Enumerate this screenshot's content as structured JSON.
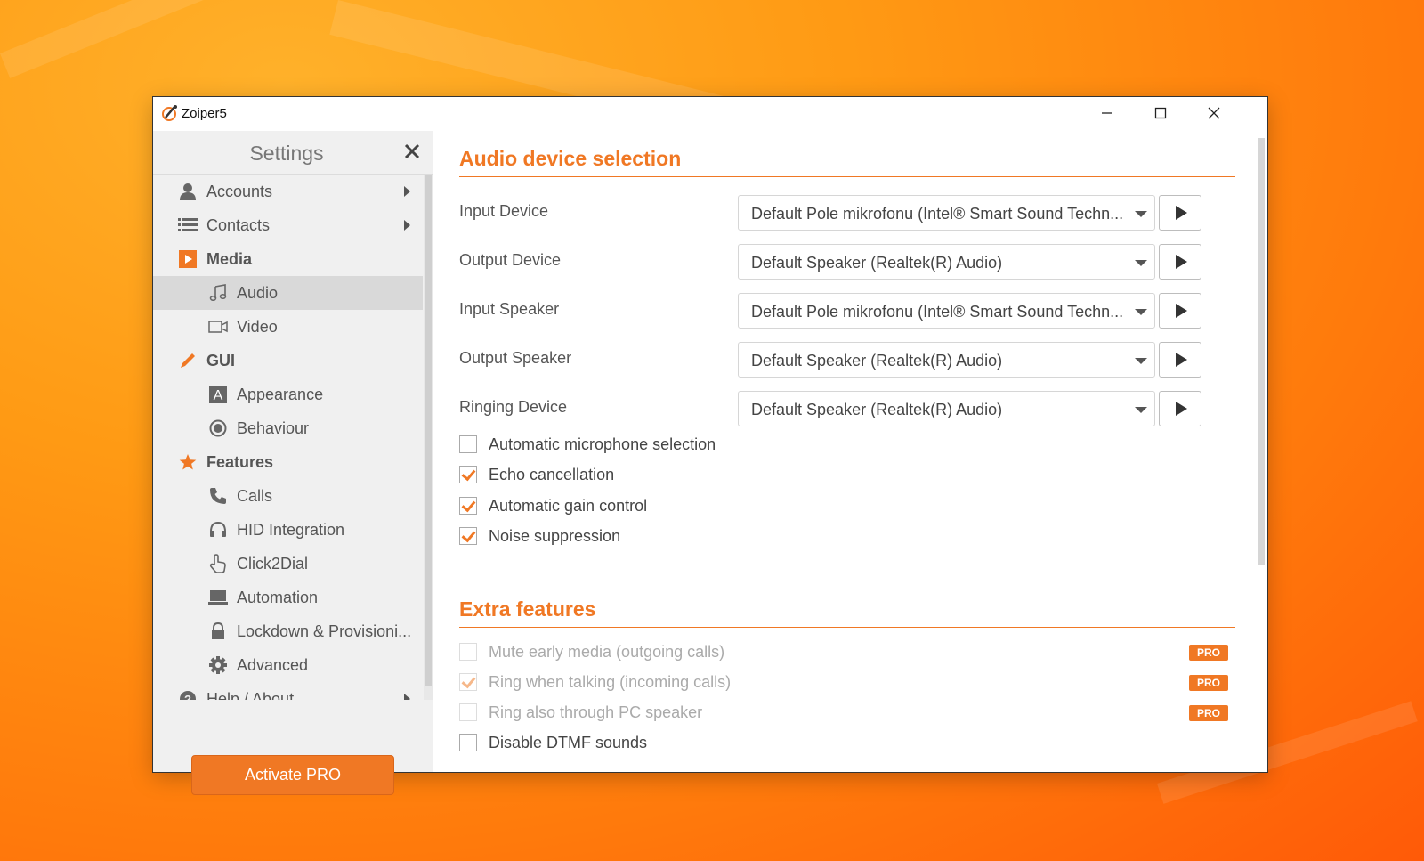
{
  "window": {
    "title": "Zoiper5"
  },
  "sidebar": {
    "title": "Settings",
    "items": [
      {
        "label": "Accounts",
        "icon": "user-icon"
      },
      {
        "label": "Contacts",
        "icon": "list-icon"
      },
      {
        "label": "Media",
        "icon": "media-play-icon"
      },
      {
        "label": "Audio",
        "icon": "music-note-icon"
      },
      {
        "label": "Video",
        "icon": "video-camera-icon"
      },
      {
        "label": "GUI",
        "icon": "pencil-icon"
      },
      {
        "label": "Appearance",
        "icon": "appearance-a-icon"
      },
      {
        "label": "Behaviour",
        "icon": "radio-circle-icon"
      },
      {
        "label": "Features",
        "icon": "star-icon"
      },
      {
        "label": "Calls",
        "icon": "phone-icon"
      },
      {
        "label": "HID Integration",
        "icon": "headset-icon"
      },
      {
        "label": "Click2Dial",
        "icon": "hand-pointer-icon"
      },
      {
        "label": "Automation",
        "icon": "laptop-icon"
      },
      {
        "label": "Lockdown & Provisioni...",
        "icon": "lock-icon"
      },
      {
        "label": "Advanced",
        "icon": "gear-icon"
      },
      {
        "label": "Help / About",
        "icon": "help-icon"
      }
    ],
    "activate_label": "Activate PRO"
  },
  "audio": {
    "title": "Audio device selection",
    "devices": [
      {
        "label": "Input Device",
        "value": "Default Pole mikrofonu (Intel® Smart Sound Techn..."
      },
      {
        "label": "Output Device",
        "value": "Default Speaker (Realtek(R) Audio)"
      },
      {
        "label": "Input Speaker",
        "value": "Default Pole mikrofonu (Intel® Smart Sound Techn..."
      },
      {
        "label": "Output Speaker",
        "value": "Default Speaker (Realtek(R) Audio)"
      },
      {
        "label": "Ringing Device",
        "value": "Default Speaker (Realtek(R) Audio)"
      }
    ],
    "options": [
      {
        "label": "Automatic microphone selection",
        "checked": false
      },
      {
        "label": "Echo cancellation",
        "checked": true
      },
      {
        "label": "Automatic gain control",
        "checked": true
      },
      {
        "label": "Noise suppression",
        "checked": true
      }
    ]
  },
  "extra": {
    "title": "Extra features",
    "options": [
      {
        "label": "Mute early media (outgoing calls)",
        "checked": false,
        "disabled": true,
        "badge": "PRO"
      },
      {
        "label": "Ring when talking (incoming calls)",
        "checked": true,
        "disabled": true,
        "badge": "PRO"
      },
      {
        "label": "Ring also through PC speaker",
        "checked": false,
        "disabled": true,
        "badge": "PRO"
      },
      {
        "label": "Disable DTMF sounds",
        "checked": false,
        "disabled": false
      }
    ]
  },
  "colors": {
    "accent": "#f07824",
    "sidebar_bg": "#f0f0f0",
    "selected_bg": "#d9d9d9"
  }
}
